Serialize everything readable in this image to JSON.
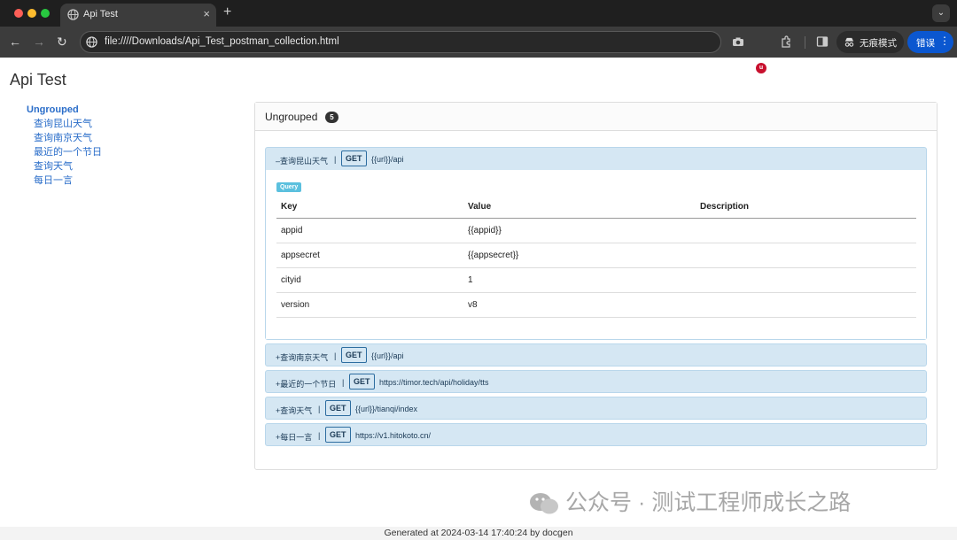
{
  "browser": {
    "tab_title": "Api Test",
    "url": "file:////Downloads/Api_Test_postman_collection.html",
    "incognito_label": "无痕模式",
    "error_label": "错误",
    "ext_badge": "u"
  },
  "page": {
    "title": "Api Test",
    "footer": "Generated at 2024-03-14 17:40:24 by docgen"
  },
  "sidebar": {
    "group": "Ungrouped",
    "items": [
      "查询昆山天气",
      "查询南京天气",
      "最近的一个节日",
      "查询天气",
      "每日一言"
    ]
  },
  "panel": {
    "title": "Ungrouped",
    "count": "5"
  },
  "requests": [
    {
      "toggle": "–",
      "name": "查询昆山天气",
      "sep": "|",
      "method": "GET",
      "endpoint": "{{url}}/api"
    },
    {
      "toggle": "+",
      "name": "查询南京天气",
      "sep": "|",
      "method": "GET",
      "endpoint": "{{url}}/api"
    },
    {
      "toggle": "+",
      "name": "最近的一个节日",
      "sep": "|",
      "method": "GET",
      "endpoint": "https://timor.tech/api/holiday/tts"
    },
    {
      "toggle": "+",
      "name": "查询天气",
      "sep": "|",
      "method": "GET",
      "endpoint": "{{url}}/tianqi/index"
    },
    {
      "toggle": "+",
      "name": "每日一言",
      "sep": "|",
      "method": "GET",
      "endpoint": "https://v1.hitokoto.cn/"
    }
  ],
  "query": {
    "badge": "Query",
    "headers": [
      "Key",
      "Value",
      "Description"
    ],
    "rows": [
      [
        "appid",
        "{{appid}}",
        ""
      ],
      [
        "appsecret",
        "{{appsecret}}",
        ""
      ],
      [
        "cityid",
        "1",
        ""
      ],
      [
        "version",
        "v8",
        ""
      ]
    ]
  },
  "watermark": "公众号 · 测试工程师成长之路",
  "colors": {
    "accent": "#2a6dc9",
    "request_bg": "#d5e7f3",
    "error_button": "#0b57d0"
  }
}
